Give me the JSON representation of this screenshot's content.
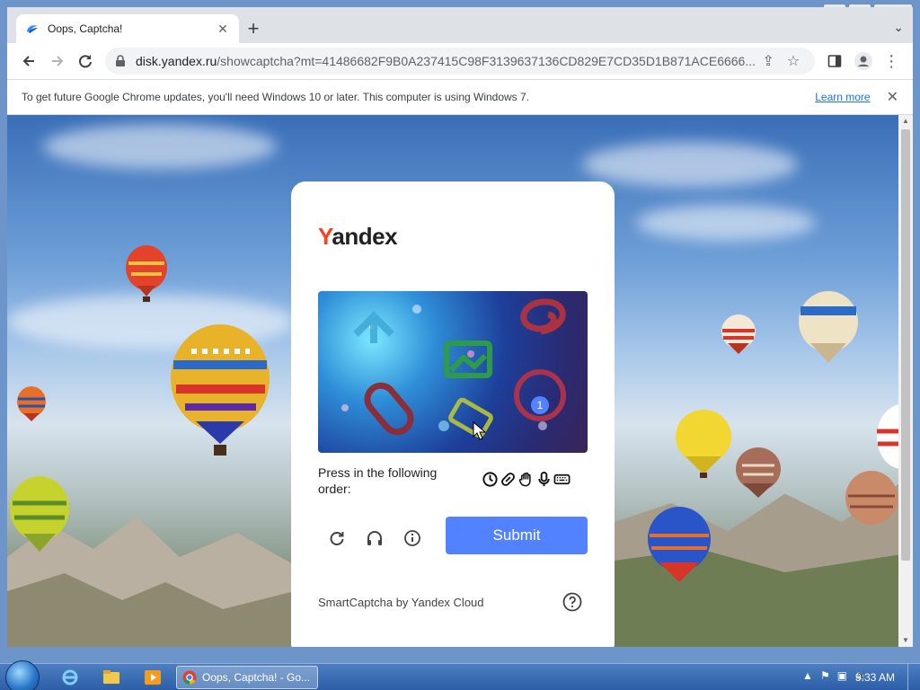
{
  "browser": {
    "tab": {
      "title": "Oops, Captcha!"
    },
    "url": {
      "host": "disk.yandex.ru",
      "path": "/showcaptcha?mt=41486682F9B0A237415C98F3139637136CD829E7CD35D1B871ACE6666..."
    },
    "infobar": {
      "message": "To get future Google Chrome updates, you'll need Windows 10 or later. This computer is using Windows 7.",
      "link": "Learn more"
    }
  },
  "captcha": {
    "brand": {
      "y": "Y",
      "rest": "andex"
    },
    "challenge_badge": "1",
    "instruction": "Press in the following order:",
    "order_icons": [
      "clock-icon",
      "link-icon",
      "hand-icon",
      "microphone-icon",
      "keyboard-icon"
    ],
    "submit_label": "Submit",
    "footer": "SmartCaptcha by Yandex Cloud"
  },
  "taskbar": {
    "chrome_title": "Oops, Captcha! - Go...",
    "clock": "9:33 AM"
  },
  "colors": {
    "accent": "#5282ff",
    "yandex_red": "#fc3f1d",
    "link": "#1a73e8"
  }
}
